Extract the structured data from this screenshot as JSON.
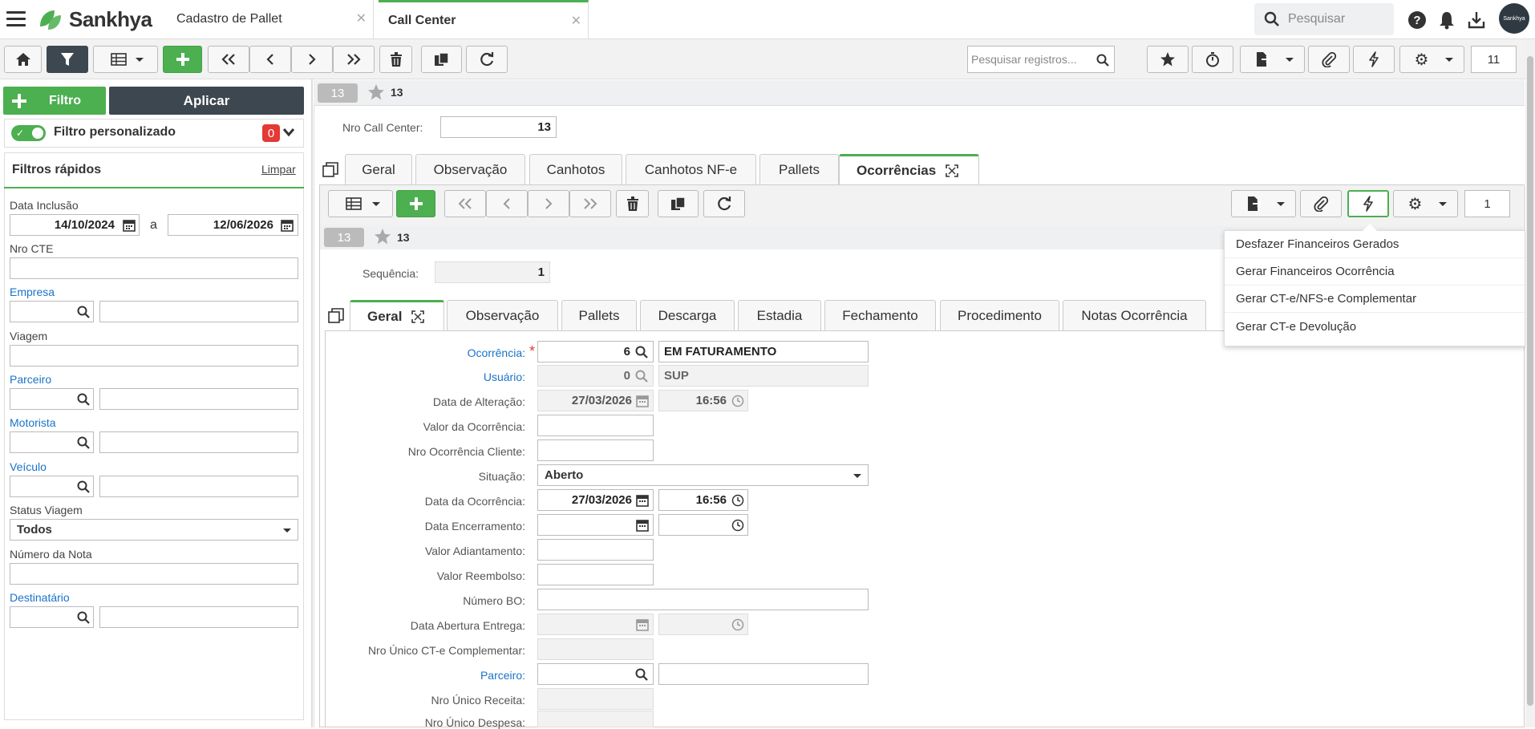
{
  "header": {
    "brand": "Sankhya",
    "tabs": [
      {
        "label": "Cadastro de Pallet"
      },
      {
        "label": "Call Center"
      }
    ],
    "search_placeholder": "Pesquisar",
    "avatar_text": "Sankhya"
  },
  "toolbar": {
    "search_placeholder": "Pesquisar registros...",
    "record_count": "11"
  },
  "left_panel": {
    "filter_button": "Filtro",
    "apply_button": "Aplicar",
    "custom_filter_label": "Filtro personalizado",
    "custom_filter_count": "0",
    "quick_filters_title": "Filtros rápidos",
    "clear_link": "Limpar",
    "date_label": "Data Inclusão",
    "date_from": "14/10/2024",
    "date_sep": "a",
    "date_to": "12/06/2026",
    "nro_cte": "Nro CTE",
    "empresa": "Empresa",
    "viagem": "Viagem",
    "parceiro": "Parceiro",
    "motorista": "Motorista",
    "veiculo": "Veículo",
    "status_viagem": "Status Viagem",
    "status_value": "Todos",
    "numero_nota": "Número da Nota",
    "destinatario": "Destinatário"
  },
  "record": {
    "id": "13",
    "fav": "13",
    "nro_call_center_label": "Nro Call Center:",
    "nro_call_center": "13"
  },
  "main_tabs": [
    "Geral",
    "Observação",
    "Canhotos",
    "Canhotos NF-e",
    "Pallets",
    "Ocorrências"
  ],
  "sub_record": {
    "id": "13",
    "fav": "13",
    "count": "1",
    "sequencia_label": "Sequência:",
    "sequencia": "1"
  },
  "sub_tabs": [
    "Geral",
    "Observação",
    "Pallets",
    "Descarga",
    "Estadia",
    "Fechamento",
    "Procedimento",
    "Notas Ocorrência"
  ],
  "form": {
    "ocorrencia_label": "Ocorrência:",
    "ocorrencia_code": "6",
    "ocorrencia_desc": "EM FATURAMENTO",
    "usuario_label": "Usuário:",
    "usuario_code": "0",
    "usuario_desc": "SUP",
    "data_alteracao_label": "Data de Alteração:",
    "data_alteracao": "27/03/2026",
    "hora_alteracao": "16:56",
    "valor_ocorrencia_label": "Valor da Ocorrência:",
    "nro_ocorrencia_cliente_label": "Nro Ocorrência Cliente:",
    "situacao_label": "Situação:",
    "situacao": "Aberto",
    "data_ocorrencia_label": "Data da Ocorrência:",
    "data_ocorrencia": "27/03/2026",
    "hora_ocorrencia": "16:56",
    "data_encerramento_label": "Data Encerramento:",
    "valor_adiantamento_label": "Valor Adiantamento:",
    "valor_reembolso_label": "Valor Reembolso:",
    "numero_bo_label": "Número BO:",
    "data_abertura_entrega_label": "Data Abertura Entrega:",
    "nro_unico_cte_label": "Nro Único CT-e Complementar:",
    "parceiro_label": "Parceiro:",
    "nro_unico_receita_label": "Nro Único Receita:",
    "nro_unico_despesa_label": "Nro Único Despesa:"
  },
  "action_menu": [
    "Desfazer Financeiros Gerados",
    "Gerar Financeiros Ocorrência",
    "Gerar CT-e/NFS-e Complementar",
    "Gerar CT-e Devolução"
  ],
  "colors": {
    "accent": "#4caf50",
    "link": "#1a73c8",
    "dark": "#3d4750",
    "badge": "#e53935"
  }
}
